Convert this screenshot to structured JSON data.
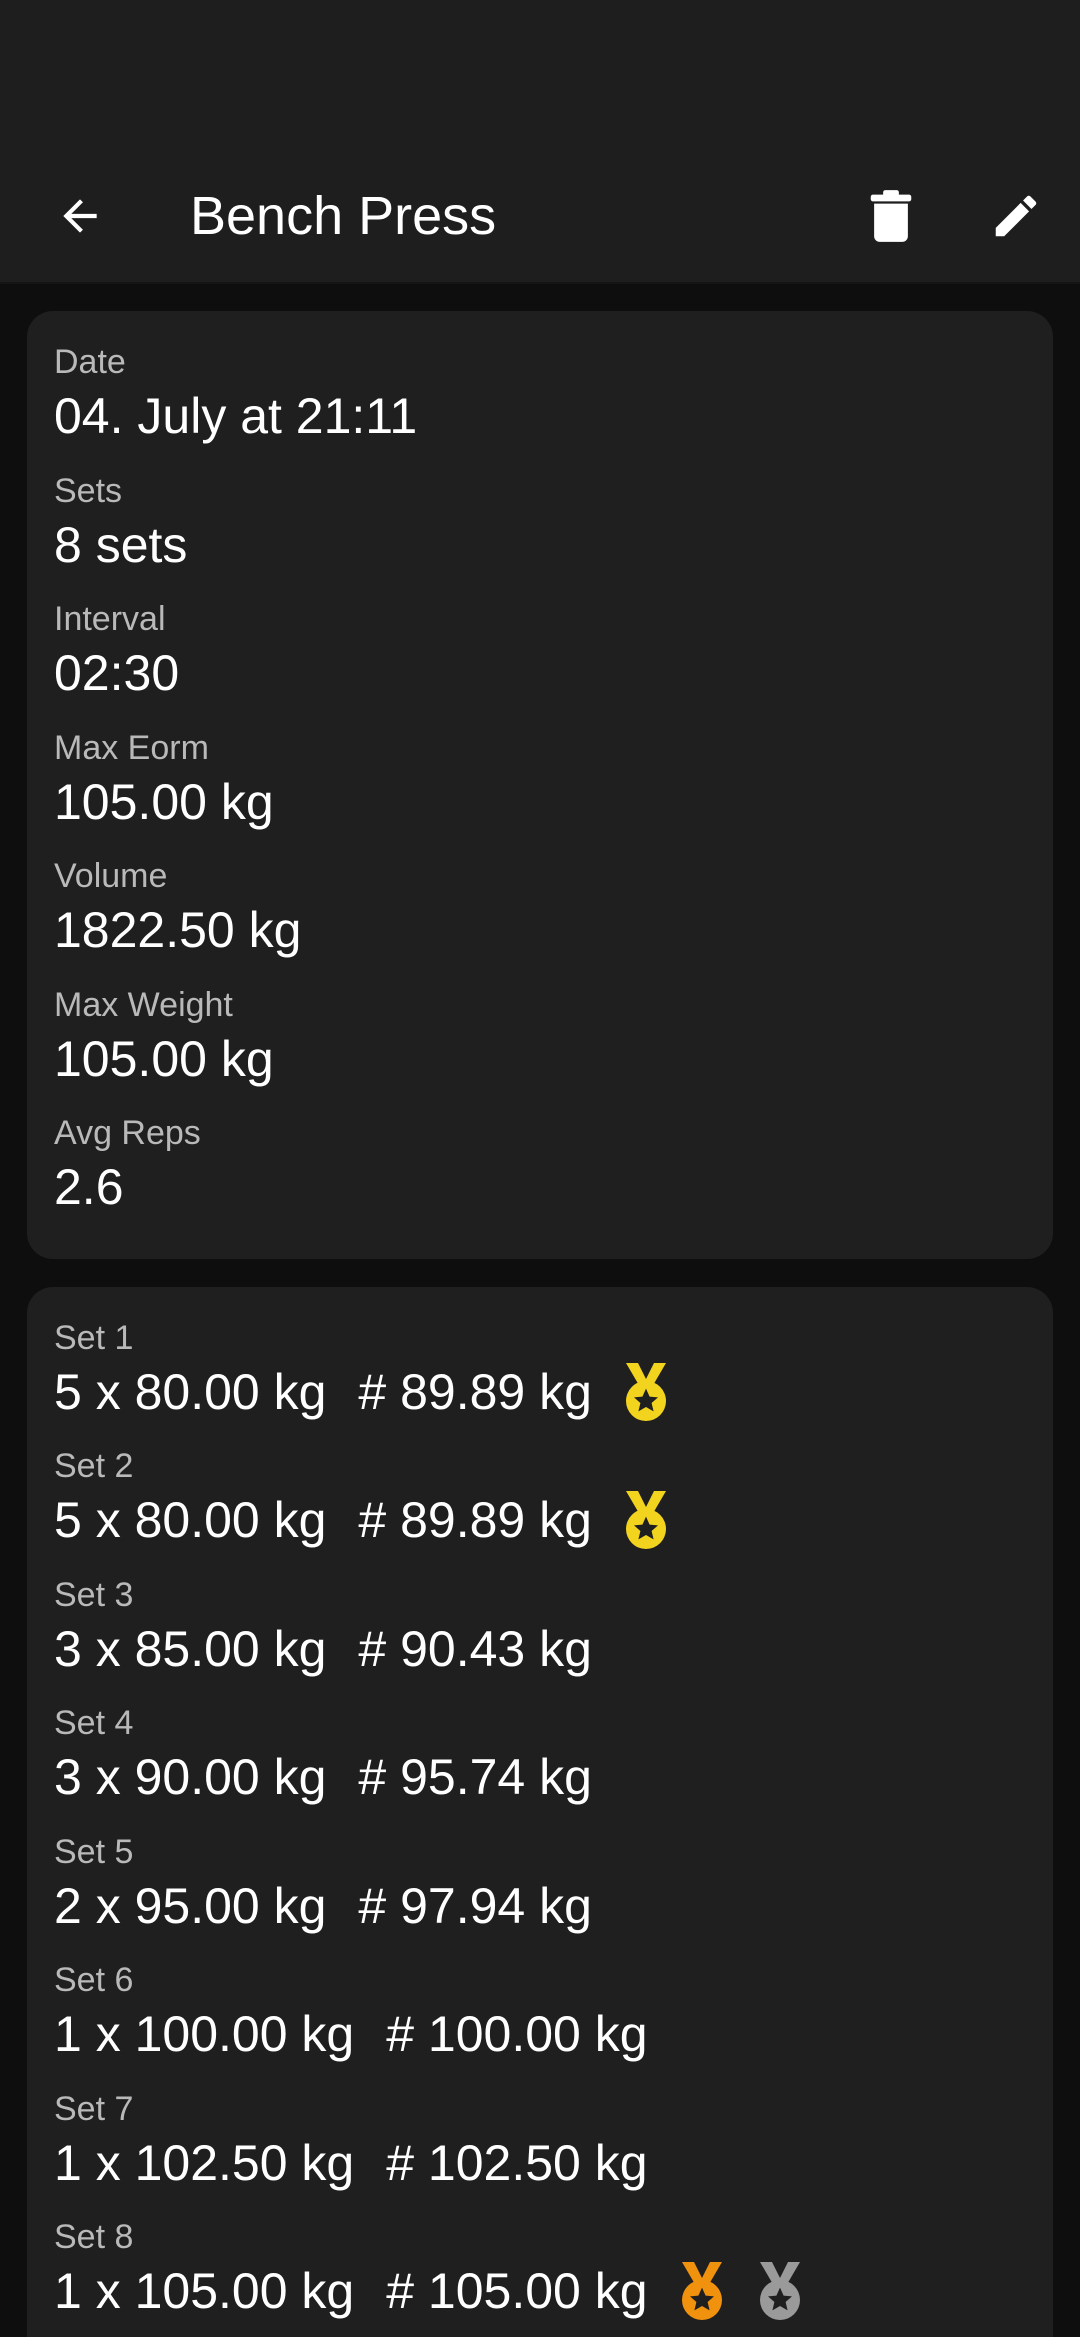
{
  "app_bar": {
    "title": "Bench Press",
    "back_icon": "arrow-left-icon",
    "delete_icon": "trash-icon",
    "edit_icon": "pencil-icon"
  },
  "summary": {
    "fields": [
      {
        "label": "Date",
        "value": "04. July at 21:11"
      },
      {
        "label": "Sets",
        "value": "8 sets"
      },
      {
        "label": "Interval",
        "value": "02:30"
      },
      {
        "label": "Max Eorm",
        "value": "105.00 kg"
      },
      {
        "label": "Volume",
        "value": "1822.50 kg"
      },
      {
        "label": "Max Weight",
        "value": "105.00 kg"
      },
      {
        "label": "Avg Reps",
        "value": "2.6"
      }
    ]
  },
  "sets": [
    {
      "label": "Set 1",
      "value": "5 x 80.00 kg",
      "orm": "# 89.89 kg",
      "medals": [
        "gold"
      ]
    },
    {
      "label": "Set 2",
      "value": "5 x 80.00 kg",
      "orm": "# 89.89 kg",
      "medals": [
        "gold"
      ]
    },
    {
      "label": "Set 3",
      "value": "3 x 85.00 kg",
      "orm": "# 90.43 kg",
      "medals": []
    },
    {
      "label": "Set 4",
      "value": "3 x 90.00 kg",
      "orm": "# 95.74 kg",
      "medals": []
    },
    {
      "label": "Set 5",
      "value": "2 x 95.00 kg",
      "orm": "# 97.94 kg",
      "medals": []
    },
    {
      "label": "Set 6",
      "value": "1 x 100.00 kg",
      "orm": "# 100.00 kg",
      "medals": []
    },
    {
      "label": "Set 7",
      "value": "1 x 102.50 kg",
      "orm": "# 102.50 kg",
      "medals": []
    },
    {
      "label": "Set 8",
      "value": "1 x 105.00 kg",
      "orm": "# 105.00 kg",
      "medals": [
        "bronze",
        "silver"
      ]
    }
  ],
  "colors": {
    "background": "#0e0e0e",
    "surface": "#1f1f1f",
    "app_bar": "#1e1e1e",
    "label": "#b9b9b9",
    "text": "#ffffff",
    "medal_gold": "#f2d41f",
    "medal_bronze": "#f0920e",
    "medal_silver": "#9a9a9a"
  }
}
